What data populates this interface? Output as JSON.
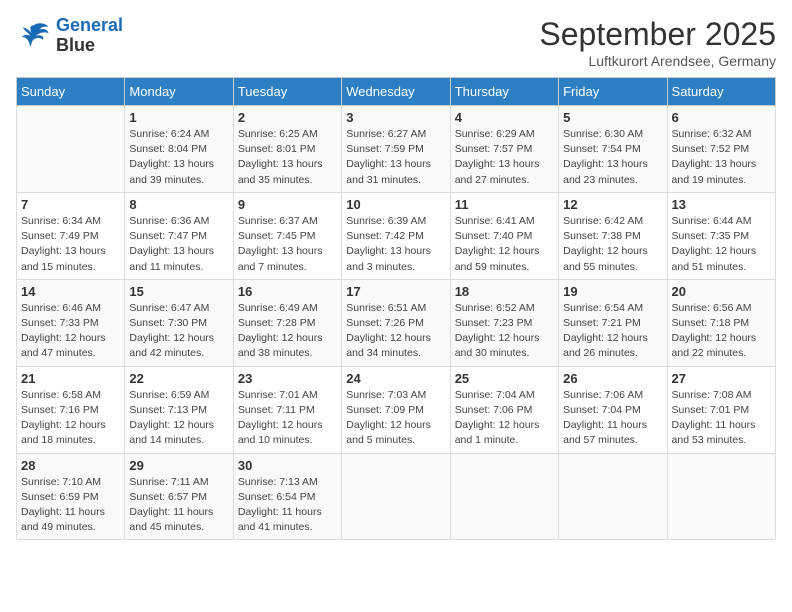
{
  "header": {
    "logo_line1": "General",
    "logo_line2": "Blue",
    "month": "September 2025",
    "location": "Luftkurort Arendsee, Germany"
  },
  "weekdays": [
    "Sunday",
    "Monday",
    "Tuesday",
    "Wednesday",
    "Thursday",
    "Friday",
    "Saturday"
  ],
  "weeks": [
    [
      {
        "day": "",
        "detail": ""
      },
      {
        "day": "1",
        "detail": "Sunrise: 6:24 AM\nSunset: 8:04 PM\nDaylight: 13 hours\nand 39 minutes."
      },
      {
        "day": "2",
        "detail": "Sunrise: 6:25 AM\nSunset: 8:01 PM\nDaylight: 13 hours\nand 35 minutes."
      },
      {
        "day": "3",
        "detail": "Sunrise: 6:27 AM\nSunset: 7:59 PM\nDaylight: 13 hours\nand 31 minutes."
      },
      {
        "day": "4",
        "detail": "Sunrise: 6:29 AM\nSunset: 7:57 PM\nDaylight: 13 hours\nand 27 minutes."
      },
      {
        "day": "5",
        "detail": "Sunrise: 6:30 AM\nSunset: 7:54 PM\nDaylight: 13 hours\nand 23 minutes."
      },
      {
        "day": "6",
        "detail": "Sunrise: 6:32 AM\nSunset: 7:52 PM\nDaylight: 13 hours\nand 19 minutes."
      }
    ],
    [
      {
        "day": "7",
        "detail": "Sunrise: 6:34 AM\nSunset: 7:49 PM\nDaylight: 13 hours\nand 15 minutes."
      },
      {
        "day": "8",
        "detail": "Sunrise: 6:36 AM\nSunset: 7:47 PM\nDaylight: 13 hours\nand 11 minutes."
      },
      {
        "day": "9",
        "detail": "Sunrise: 6:37 AM\nSunset: 7:45 PM\nDaylight: 13 hours\nand 7 minutes."
      },
      {
        "day": "10",
        "detail": "Sunrise: 6:39 AM\nSunset: 7:42 PM\nDaylight: 13 hours\nand 3 minutes."
      },
      {
        "day": "11",
        "detail": "Sunrise: 6:41 AM\nSunset: 7:40 PM\nDaylight: 12 hours\nand 59 minutes."
      },
      {
        "day": "12",
        "detail": "Sunrise: 6:42 AM\nSunset: 7:38 PM\nDaylight: 12 hours\nand 55 minutes."
      },
      {
        "day": "13",
        "detail": "Sunrise: 6:44 AM\nSunset: 7:35 PM\nDaylight: 12 hours\nand 51 minutes."
      }
    ],
    [
      {
        "day": "14",
        "detail": "Sunrise: 6:46 AM\nSunset: 7:33 PM\nDaylight: 12 hours\nand 47 minutes."
      },
      {
        "day": "15",
        "detail": "Sunrise: 6:47 AM\nSunset: 7:30 PM\nDaylight: 12 hours\nand 42 minutes."
      },
      {
        "day": "16",
        "detail": "Sunrise: 6:49 AM\nSunset: 7:28 PM\nDaylight: 12 hours\nand 38 minutes."
      },
      {
        "day": "17",
        "detail": "Sunrise: 6:51 AM\nSunset: 7:26 PM\nDaylight: 12 hours\nand 34 minutes."
      },
      {
        "day": "18",
        "detail": "Sunrise: 6:52 AM\nSunset: 7:23 PM\nDaylight: 12 hours\nand 30 minutes."
      },
      {
        "day": "19",
        "detail": "Sunrise: 6:54 AM\nSunset: 7:21 PM\nDaylight: 12 hours\nand 26 minutes."
      },
      {
        "day": "20",
        "detail": "Sunrise: 6:56 AM\nSunset: 7:18 PM\nDaylight: 12 hours\nand 22 minutes."
      }
    ],
    [
      {
        "day": "21",
        "detail": "Sunrise: 6:58 AM\nSunset: 7:16 PM\nDaylight: 12 hours\nand 18 minutes."
      },
      {
        "day": "22",
        "detail": "Sunrise: 6:59 AM\nSunset: 7:13 PM\nDaylight: 12 hours\nand 14 minutes."
      },
      {
        "day": "23",
        "detail": "Sunrise: 7:01 AM\nSunset: 7:11 PM\nDaylight: 12 hours\nand 10 minutes."
      },
      {
        "day": "24",
        "detail": "Sunrise: 7:03 AM\nSunset: 7:09 PM\nDaylight: 12 hours\nand 5 minutes."
      },
      {
        "day": "25",
        "detail": "Sunrise: 7:04 AM\nSunset: 7:06 PM\nDaylight: 12 hours\nand 1 minute."
      },
      {
        "day": "26",
        "detail": "Sunrise: 7:06 AM\nSunset: 7:04 PM\nDaylight: 11 hours\nand 57 minutes."
      },
      {
        "day": "27",
        "detail": "Sunrise: 7:08 AM\nSunset: 7:01 PM\nDaylight: 11 hours\nand 53 minutes."
      }
    ],
    [
      {
        "day": "28",
        "detail": "Sunrise: 7:10 AM\nSunset: 6:59 PM\nDaylight: 11 hours\nand 49 minutes."
      },
      {
        "day": "29",
        "detail": "Sunrise: 7:11 AM\nSunset: 6:57 PM\nDaylight: 11 hours\nand 45 minutes."
      },
      {
        "day": "30",
        "detail": "Sunrise: 7:13 AM\nSunset: 6:54 PM\nDaylight: 11 hours\nand 41 minutes."
      },
      {
        "day": "",
        "detail": ""
      },
      {
        "day": "",
        "detail": ""
      },
      {
        "day": "",
        "detail": ""
      },
      {
        "day": "",
        "detail": ""
      }
    ]
  ]
}
